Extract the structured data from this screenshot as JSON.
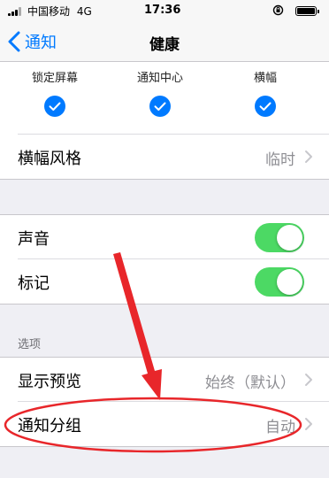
{
  "status_bar": {
    "carrier": "中国移动",
    "network": "4G",
    "time": "17:36"
  },
  "nav": {
    "back_label": "通知",
    "title": "健康"
  },
  "alerts": {
    "items": [
      {
        "label": "锁定屏幕",
        "checked": true
      },
      {
        "label": "通知中心",
        "checked": true
      },
      {
        "label": "横幅",
        "checked": true
      }
    ]
  },
  "banner_style": {
    "label": "横幅风格",
    "value": "临时"
  },
  "sound": {
    "label": "声音",
    "on": true
  },
  "badges": {
    "label": "标记",
    "on": true
  },
  "options_section": {
    "header": "选项"
  },
  "show_previews": {
    "label": "显示预览",
    "value": "始终（默认）"
  },
  "notification_grouping": {
    "label": "通知分组",
    "value": "自动"
  },
  "colors": {
    "accent": "#007aff",
    "toggle_on": "#4cd964",
    "annotation": "#e8262a"
  }
}
